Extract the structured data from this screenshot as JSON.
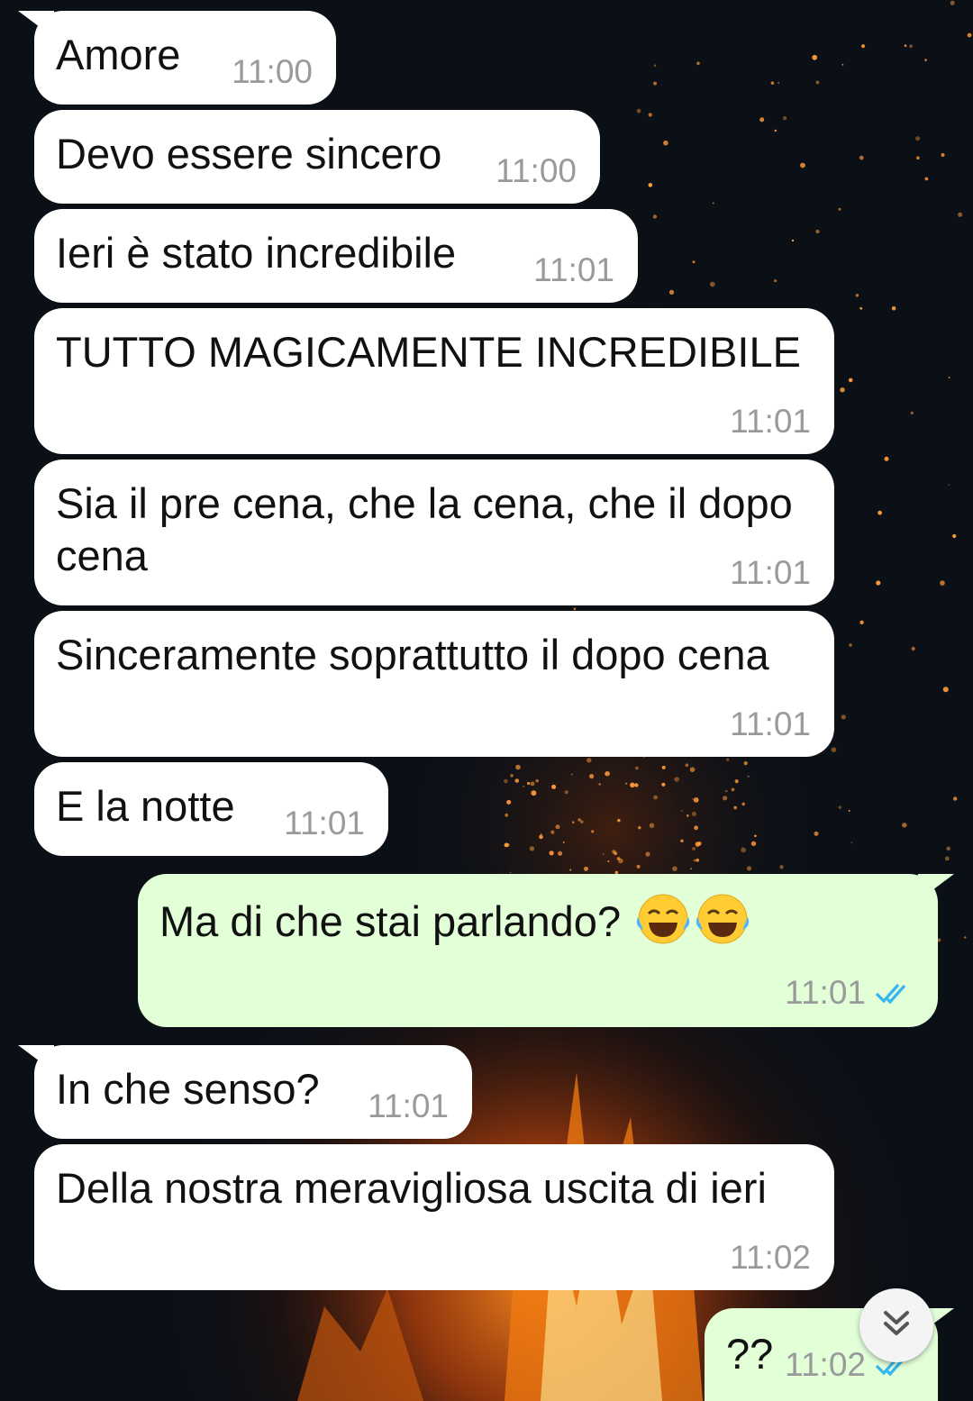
{
  "messages": [
    {
      "dir": "in",
      "text": "Amore",
      "time": "11:00"
    },
    {
      "dir": "in",
      "text": "Devo essere sincero",
      "time": "11:00"
    },
    {
      "dir": "in",
      "text": "Ieri è stato incredibile",
      "time": "11:01"
    },
    {
      "dir": "in",
      "text": "TUTTO MAGICAMENTE INCREDIBILE",
      "time": "11:01"
    },
    {
      "dir": "in",
      "text": "Sia il pre cena, che la cena, che il dopo cena",
      "time": "11:01"
    },
    {
      "dir": "in",
      "text": "Sinceramente soprattutto il dopo cena",
      "time": "11:01"
    },
    {
      "dir": "in",
      "text": "E la notte",
      "time": "11:01"
    },
    {
      "dir": "out",
      "text": "Ma di che stai parlando?",
      "emoji": "😂😂",
      "time": "11:01",
      "status": "read"
    },
    {
      "dir": "in",
      "text": "In che senso?",
      "time": "11:01"
    },
    {
      "dir": "in",
      "text": "Della nostra meravigliosa uscita di ieri",
      "time": "11:02"
    },
    {
      "dir": "out",
      "text": "??",
      "time": "11:02",
      "status": "read"
    }
  ],
  "icons": {
    "read_ticks": "double-check-icon",
    "scroll_down": "chevrons-down-icon",
    "emoji": "face-with-tears-of-joy"
  },
  "colors": {
    "incoming_bubble": "#ffffff",
    "outgoing_bubble": "#e2ffd8",
    "timestamp": "#9a9a9a",
    "read_ticks": "#34b7f1"
  }
}
